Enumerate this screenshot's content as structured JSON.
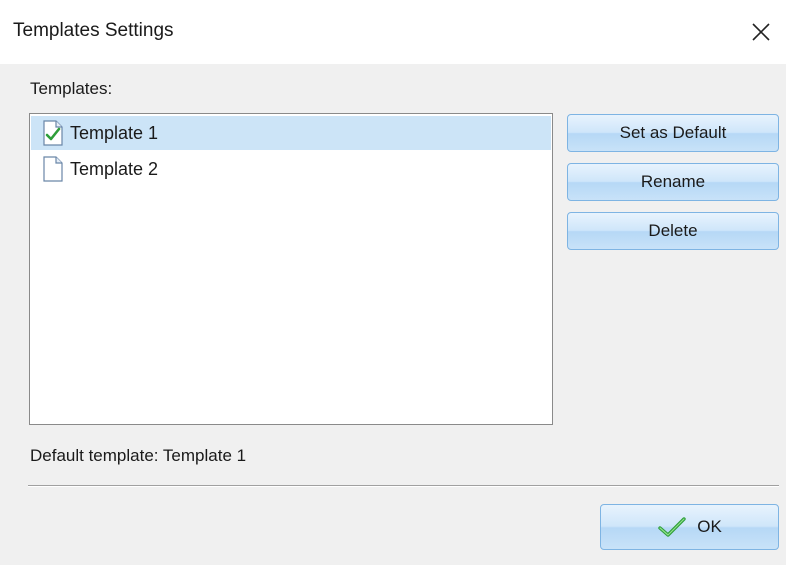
{
  "window": {
    "title": "Templates Settings",
    "close_icon": "close-icon"
  },
  "templates": {
    "label": "Templates:",
    "items": [
      {
        "label": "Template 1",
        "icon": "checked-document-icon",
        "selected": true,
        "is_default": true
      },
      {
        "label": "Template 2",
        "icon": "document-icon",
        "selected": false,
        "is_default": false
      }
    ]
  },
  "actions": {
    "set_default_label": "Set as Default",
    "rename_label": "Rename",
    "delete_label": "Delete"
  },
  "status": {
    "default_template_text": "Default template: Template 1"
  },
  "footer": {
    "ok_label": "OK",
    "ok_icon": "checkmark-icon"
  },
  "colors": {
    "selection": "#cce4f7",
    "button_border": "#7eb4e3",
    "check_green": "#2e9e3a"
  }
}
